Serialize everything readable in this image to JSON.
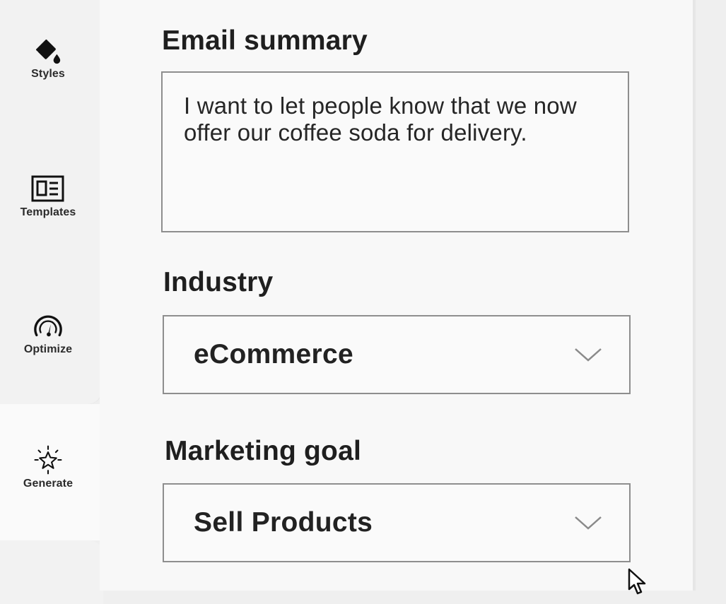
{
  "sidebar": {
    "items": [
      {
        "label": "Styles",
        "icon": "paint-bucket-icon"
      },
      {
        "label": "Templates",
        "icon": "template-icon"
      },
      {
        "label": "Optimize",
        "icon": "gauge-icon"
      },
      {
        "label": "Generate",
        "icon": "sparkle-star-icon",
        "active": true
      }
    ]
  },
  "form": {
    "email_summary": {
      "label": "Email summary",
      "value": "I want to let people know that we now offer our coffee soda for delivery."
    },
    "industry": {
      "label": "Industry",
      "selected": "eCommerce"
    },
    "marketing_goal": {
      "label": "Marketing goal",
      "selected": "Sell Products"
    }
  },
  "colors": {
    "panel_bg": "#f8f8f8",
    "sidebar_bg": "#f2f2f2",
    "border": "#8e8e8e",
    "text": "#232323"
  }
}
